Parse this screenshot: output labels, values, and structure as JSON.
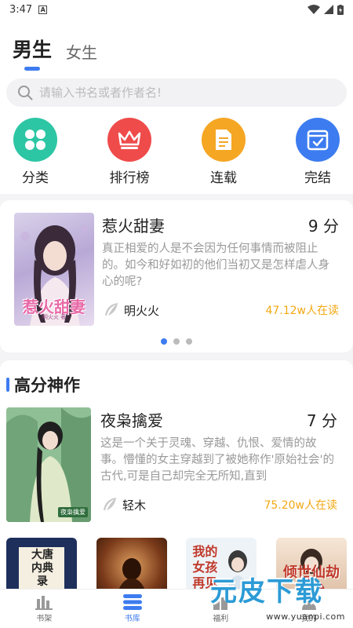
{
  "status_bar": {
    "time": "3:47",
    "badge": "A"
  },
  "tabs": [
    {
      "label": "男生",
      "active": true
    },
    {
      "label": "女生",
      "active": false
    }
  ],
  "search": {
    "placeholder": "请输入书名或者作者名!"
  },
  "categories": [
    {
      "label": "分类",
      "icon": "grid-icon",
      "color": "#2dc6a4"
    },
    {
      "label": "排行榜",
      "icon": "crown-icon",
      "color": "#ef4b4b"
    },
    {
      "label": "连载",
      "icon": "document-icon",
      "color": "#f5a623"
    },
    {
      "label": "完结",
      "icon": "calendar-check-icon",
      "color": "#3d7cf0"
    }
  ],
  "featured": {
    "title": "惹火甜妻",
    "score": "9 分",
    "description": "真正相爱的人是不会因为任何事情而被阻止的。如今和好如初的他们当初又是怎样虐人身心的呢?",
    "author": "明火火",
    "readers": "47.12w人在读",
    "cover_title": "惹火甜妻",
    "cover_subtitle": "明火火 著"
  },
  "carousel": {
    "count": 3,
    "active": 0
  },
  "section": {
    "title": "高分神作",
    "book": {
      "title": "夜枭擒爱",
      "score": "7 分",
      "description": "这是一个关于灵魂、穿越、仇恨、爱情的故事。懵懂的女主穿越到了被她称作'原始社会'的古代,可是自己却完全无所知,直到",
      "author": "轻木",
      "readers": "75.20w人在读",
      "cover_tag": "夜枭擒爱"
    },
    "shelf": [
      {
        "cover_text": "大唐内典录"
      },
      {
        "cover_text": ""
      },
      {
        "cover_text": "我的女孩 再见"
      },
      {
        "cover_text": "倾世仙劫"
      }
    ]
  },
  "bottom_nav": [
    {
      "label": "书架",
      "icon": "bookshelf-icon",
      "active": false
    },
    {
      "label": "书库",
      "icon": "library-icon",
      "active": true
    },
    {
      "label": "福利",
      "icon": "gift-icon",
      "active": false
    },
    {
      "label": "我的",
      "icon": "user-icon",
      "active": false
    }
  ],
  "watermark": {
    "text": "元皮下载",
    "url": "www.yuanpi.com"
  },
  "colors": {
    "accent": "#3d7cf0",
    "readers": "#f3a814"
  }
}
